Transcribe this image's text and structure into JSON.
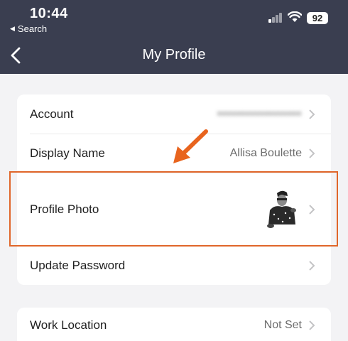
{
  "status_bar": {
    "time": "10:44",
    "back_app": "Search",
    "battery": "92"
  },
  "nav": {
    "title": "My Profile"
  },
  "rows": [
    {
      "label": "Account",
      "value": "••••••••••••••••••"
    },
    {
      "label": "Display Name",
      "value": "Allisa Boulette"
    },
    {
      "label": "Profile Photo",
      "value": ""
    },
    {
      "label": "Update Password",
      "value": ""
    }
  ],
  "rows2": [
    {
      "label": "Work Location",
      "value": "Not Set"
    }
  ],
  "colors": {
    "header_bg": "#3a3e50",
    "highlight": "#e0662a",
    "background": "#f3f3f5"
  },
  "icons": [
    "back-chevron-icon",
    "chevron-right-icon",
    "signal-icon",
    "wifi-icon",
    "battery-icon",
    "annotation-arrow-icon"
  ]
}
